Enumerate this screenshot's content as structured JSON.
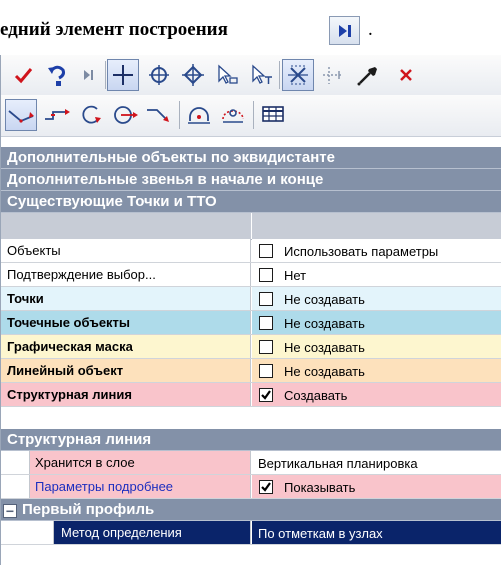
{
  "heading": {
    "text": "едний элемент построения",
    "trail": "."
  },
  "toolbar1": {
    "buttons": [
      {
        "icon": "checkmark-icon",
        "color": "#d0141c"
      },
      {
        "icon": "undo-arrow-icon",
        "color": "#1d3fa8"
      },
      {
        "icon": "go-to-last-icon",
        "color": "#4e6a9a"
      },
      {
        "icon": "crosshair-plus-icon",
        "color": "#1c2f66"
      },
      {
        "icon": "target-circle-icon",
        "color": "#2a4a8c"
      },
      {
        "icon": "target-diamond-icon",
        "color": "#2a4a8c"
      },
      {
        "icon": "cursor-select-icon",
        "color": "#2a4a8c"
      },
      {
        "icon": "cursor-text-icon",
        "color": "#2a4a8c"
      },
      {
        "icon": "snap-grid-icon",
        "color": "#2a4a8c"
      },
      {
        "icon": "dotted-cross-icon",
        "color": "#8a97ad"
      },
      {
        "icon": "eyedropper-icon",
        "color": "#1c1c1c"
      },
      {
        "icon": "close-icon",
        "color": "#d0141c"
      }
    ]
  },
  "toolbar2": {
    "buttons": [
      {
        "icon": "line-arrow-icon",
        "color": "#d0141c"
      },
      {
        "icon": "line-step-icon",
        "color": "#d0141c"
      },
      {
        "icon": "arc-arrow-icon",
        "color": "#d0141c"
      },
      {
        "icon": "circle-arrow-icon",
        "color": "#d0141c"
      },
      {
        "icon": "polyline-arrow-icon",
        "color": "#d0141c"
      },
      {
        "icon": "arc-point-icon",
        "color": "#2a4a8c"
      },
      {
        "icon": "arc-dotted-icon",
        "color": "#d0141c"
      },
      {
        "icon": "table-grid-icon",
        "color": "#1c2f66"
      }
    ]
  },
  "sections": {
    "s1": "Дополнительные объекты по эквидистанте",
    "s2": "Дополнительные звенья в начале и конце",
    "s3": "Существующие Точки и ТТО",
    "s4": "Структурная линия",
    "s5": "Первый профиль",
    "s5_expander": "−"
  },
  "rows": [
    {
      "label": "Объекты",
      "value": "Использовать параметры",
      "checked": false,
      "bg": "#ffffff",
      "bold": false
    },
    {
      "label": "Подтверждение выбор...",
      "value": "Нет",
      "checked": false,
      "bg": "#ffffff",
      "bold": false
    },
    {
      "label": "Точки",
      "value": "Не создавать",
      "checked": false,
      "bg": "#e3f4fb",
      "bold": true
    },
    {
      "label": "Точечные объекты",
      "value": "Не создавать",
      "checked": false,
      "bg": "#aedbea",
      "bold": true
    },
    {
      "label": "Графическая маска",
      "value": "Не создавать",
      "checked": false,
      "bg": "#fdf6cf",
      "bold": true
    },
    {
      "label": "Линейный объект",
      "value": "Не создавать",
      "checked": false,
      "bg": "#fde1bc",
      "bold": true
    },
    {
      "label": "Структурная линия",
      "value": "Создавать",
      "checked": true,
      "bg": "#f9c4cb",
      "bold": true
    }
  ],
  "structural_rows": [
    {
      "label": "Хранится в слое",
      "value": "Вертикальная планировка",
      "bg": "#f9c4cb"
    },
    {
      "label": "Параметры подробнее",
      "value": "Показывать",
      "checked": true,
      "bg": "#f9c4cb",
      "label_color": "#1d2fbf"
    }
  ],
  "selected_row": {
    "label": "Метод определения",
    "value": "По отметкам в узлах",
    "bg": "#0a246a",
    "color": "#ffffff"
  }
}
